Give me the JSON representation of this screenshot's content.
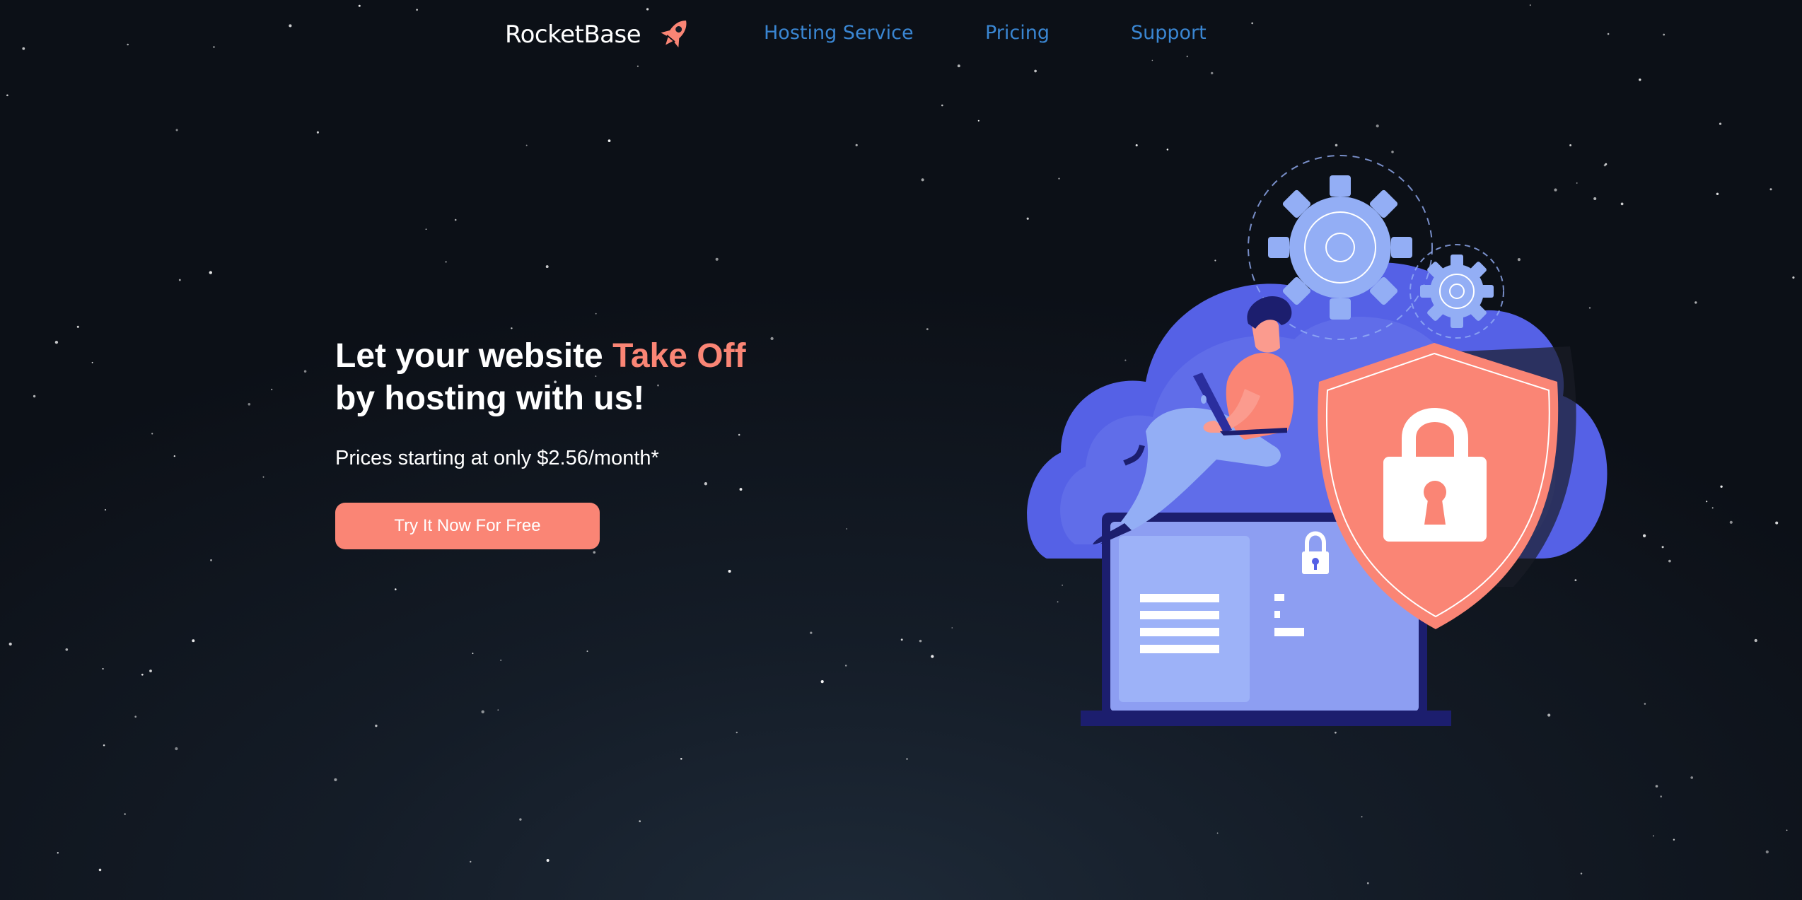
{
  "nav": {
    "brand": "RocketBase",
    "brand_icon": "rocket-icon",
    "links": [
      {
        "label": "Hosting Service"
      },
      {
        "label": "Pricing"
      },
      {
        "label": "Support"
      }
    ]
  },
  "hero": {
    "title_part1": "Let your website ",
    "title_accent": "Take Off",
    "title_part2": "by hosting with us!",
    "subtitle": "Prices starting at only $2.56/month*",
    "cta_label": "Try It Now For Free"
  },
  "colors": {
    "accent": "#fa8575",
    "link": "#3a86d2",
    "cloud": "#5561e6",
    "gear": "#93aef5"
  },
  "illustration": {
    "icons": [
      "gear-icon",
      "padlock-icon",
      "shield-icon",
      "laptop-icon",
      "cloud-icon"
    ]
  }
}
